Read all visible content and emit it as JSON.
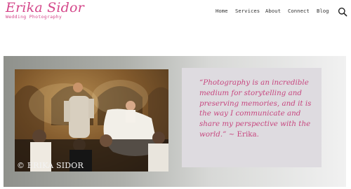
{
  "brand": {
    "name": "Erika Sidor",
    "tagline": "Wedding Photography",
    "accent_color": "#d4478a"
  },
  "nav": {
    "items": [
      {
        "label": "Home"
      },
      {
        "label": "Services"
      },
      {
        "label": "About"
      },
      {
        "label": "Connect"
      },
      {
        "label": "Blog"
      }
    ],
    "search_icon": "search-icon"
  },
  "hero": {
    "photo": {
      "watermark": "© ERIKA SIDOR"
    },
    "quote": {
      "text": "“Photography is an incredible medium for storytelling and preserving memories, and it is the way I communicate and share my perspective with the world.”",
      "attribution": "~ Erika."
    }
  }
}
